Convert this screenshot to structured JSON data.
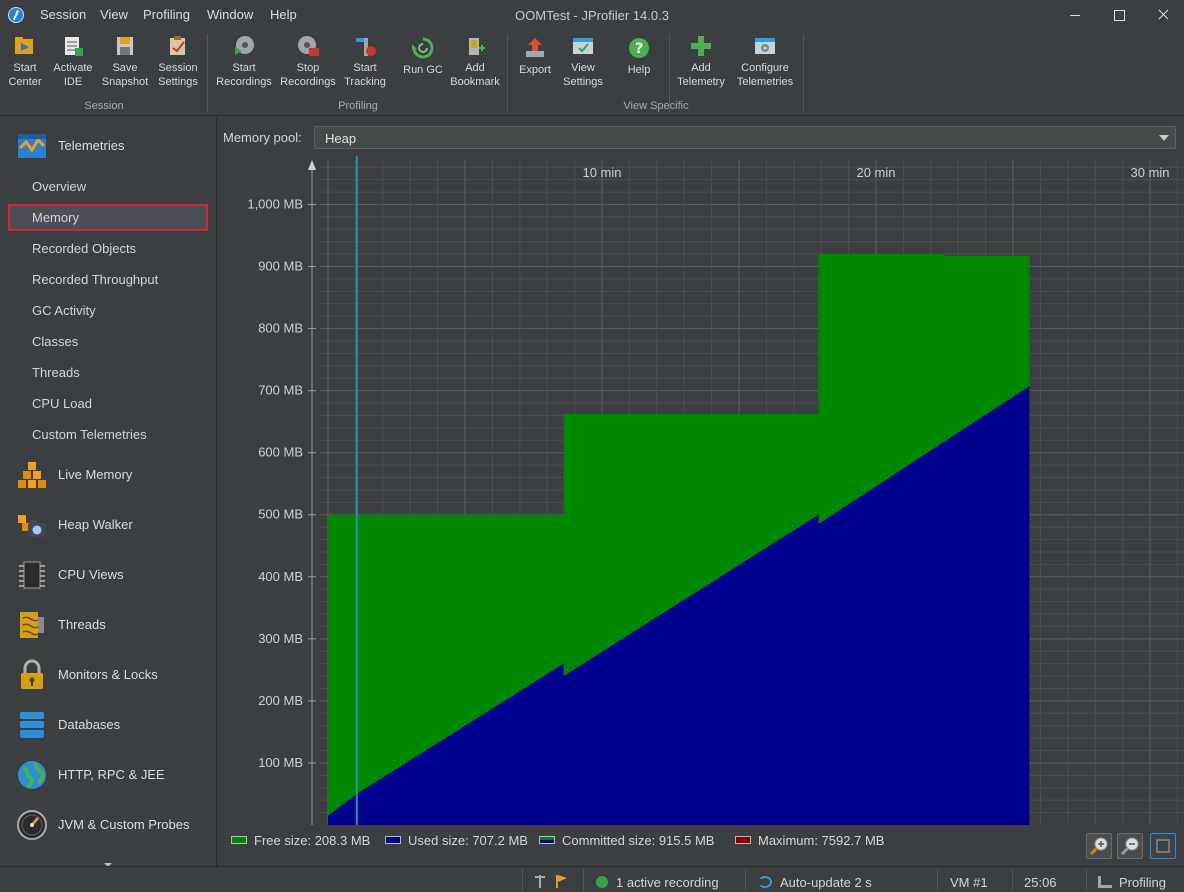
{
  "window": {
    "title": "OOMTest - JProfiler 14.0.3"
  },
  "menu": [
    "Session",
    "View",
    "Profiling",
    "Window",
    "Help"
  ],
  "toolbar": {
    "buttons": [
      {
        "line1": "Start",
        "line2": "Center"
      },
      {
        "line1": "Activate",
        "line2": "IDE"
      },
      {
        "line1": "Save",
        "line2": "Snapshot"
      },
      {
        "line1": "Session",
        "line2": "Settings"
      },
      {
        "line1": "Start",
        "line2": "Recordings"
      },
      {
        "line1": "Stop",
        "line2": "Recordings"
      },
      {
        "line1": "Start",
        "line2": "Tracking"
      },
      {
        "line1": "Run GC",
        "line2": ""
      },
      {
        "line1": "Add",
        "line2": "Bookmark"
      },
      {
        "line1": "Export",
        "line2": ""
      },
      {
        "line1": "View",
        "line2": "Settings"
      },
      {
        "line1": "Help",
        "line2": ""
      },
      {
        "line1": "Add",
        "line2": "Telemetry"
      },
      {
        "line1": "Configure",
        "line2": "Telemetries"
      }
    ],
    "groups": [
      "Session",
      "Profiling",
      "View Specific"
    ]
  },
  "sidebar": {
    "telemetries": "Telemetries",
    "sub_items": [
      "Overview",
      "Memory",
      "Recorded Objects",
      "Recorded Throughput",
      "GC Activity",
      "Classes",
      "Threads",
      "CPU Load",
      "Custom Telemetries"
    ],
    "selected": "Memory",
    "sections": [
      "Live Memory",
      "Heap Walker",
      "CPU Views",
      "Threads",
      "Monitors & Locks",
      "Databases",
      "HTTP, RPC & JEE",
      "JVM & Custom Probes"
    ]
  },
  "memory_pool": {
    "label": "Memory pool:",
    "value": "Heap"
  },
  "chart_data": {
    "type": "area",
    "x_unit": "min",
    "x_ticks": [
      "10 min",
      "20 min",
      "30 min"
    ],
    "x_tick_values": [
      10,
      20,
      30
    ],
    "y_ticks": [
      "100 MB",
      "200 MB",
      "300 MB",
      "400 MB",
      "500 MB",
      "600 MB",
      "700 MB",
      "800 MB",
      "900 MB",
      "1,000 MB"
    ],
    "y_tick_values": [
      100,
      200,
      300,
      400,
      500,
      600,
      700,
      800,
      900,
      1000
    ],
    "xlim": [
      -1,
      31
    ],
    "ylim": [
      0,
      1075
    ],
    "grid": true,
    "legend_position": "bottom",
    "series": [
      {
        "name": "Committed size",
        "color": "#008800",
        "points": [
          [
            0,
            500
          ],
          [
            8.6,
            500
          ],
          [
            8.6,
            662
          ],
          [
            17.9,
            662
          ],
          [
            17.9,
            920
          ],
          [
            22.5,
            920
          ],
          [
            22.5,
            917
          ],
          [
            25.6,
            917
          ]
        ]
      },
      {
        "name": "Used size",
        "color": "#000090",
        "points": [
          [
            0,
            15
          ],
          [
            1.05,
            50
          ],
          [
            8.6,
            260
          ],
          [
            8.6,
            240
          ],
          [
            17.9,
            500
          ],
          [
            17.9,
            485
          ],
          [
            22.5,
            618
          ],
          [
            25.6,
            707
          ]
        ]
      }
    ],
    "marker_x": 1.05,
    "legend": [
      {
        "label": "Free size:",
        "value": "208.3 MB",
        "color": "#008800"
      },
      {
        "label": "Used size:",
        "value": "707.2 MB",
        "color": "#000090"
      },
      {
        "label": "Committed size:",
        "value": "915.5 MB",
        "color": "#008800"
      },
      {
        "label": "Maximum:",
        "value": "7592.7 MB",
        "color": "#8b0000"
      }
    ]
  },
  "status": {
    "recording": "1 active recording",
    "autoupdate": "Auto-update 2 s",
    "vm": "VM #1",
    "time": "25:06",
    "mode": "Profiling"
  }
}
